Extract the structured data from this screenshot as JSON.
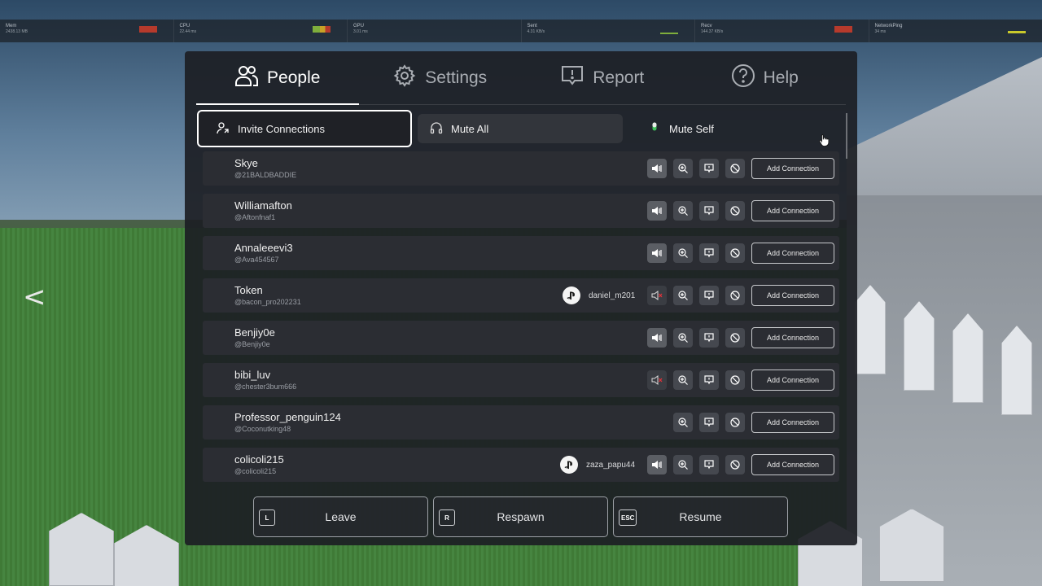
{
  "stats": [
    {
      "label": "Mem",
      "value": "2438.13 MB",
      "bar_color": "#c0392b"
    },
    {
      "label": "CPU",
      "value": "22.44 ms",
      "bar_color": "#c9a227"
    },
    {
      "label": "GPU",
      "value": "3.01 ms",
      "bar_color": ""
    },
    {
      "label": "Sent",
      "value": "4.31 KB/s",
      "bar_color": "#7fae3c"
    },
    {
      "label": "Recv",
      "value": "144.37 KB/s",
      "bar_color": "#c0392b"
    },
    {
      "label": "NetworkPing",
      "value": "34 ms",
      "bar_color": "#c9c92b"
    }
  ],
  "tabs": {
    "people": "People",
    "settings": "Settings",
    "report": "Report",
    "help": "Help"
  },
  "actions": {
    "invite": "Invite Connections",
    "mute_all": "Mute All",
    "mute_self": "Mute Self"
  },
  "add_label": "Add Connection",
  "players": [
    {
      "name": "Skye",
      "handle": "@21BALDBADDIE",
      "platform_name": "",
      "speaker": "on"
    },
    {
      "name": "Williamafton",
      "handle": "@Aftonfnaf1",
      "platform_name": "",
      "speaker": "on"
    },
    {
      "name": "Annaleeevi3",
      "handle": "@Ava454567",
      "platform_name": "",
      "speaker": "on"
    },
    {
      "name": "Token",
      "handle": "@bacon_pro202231",
      "platform_name": "daniel_m201",
      "speaker": "muted"
    },
    {
      "name": "Benjiy0e",
      "handle": "@Benjiy0e",
      "platform_name": "",
      "speaker": "on"
    },
    {
      "name": "bibi_luv",
      "handle": "@chester3bum666",
      "platform_name": "",
      "speaker": "muted"
    },
    {
      "name": "Professor_penguin124",
      "handle": "@Coconutking48",
      "platform_name": "",
      "speaker": "none"
    },
    {
      "name": "colicoli215",
      "handle": "@colicoli215",
      "platform_name": "zaza_papu44",
      "speaker": "on"
    }
  ],
  "bottom": {
    "leave": {
      "key": "L",
      "label": "Leave"
    },
    "respawn": {
      "key": "R",
      "label": "Respawn"
    },
    "resume": {
      "key": "ESC",
      "label": "Resume"
    }
  },
  "side_arrow": "<"
}
